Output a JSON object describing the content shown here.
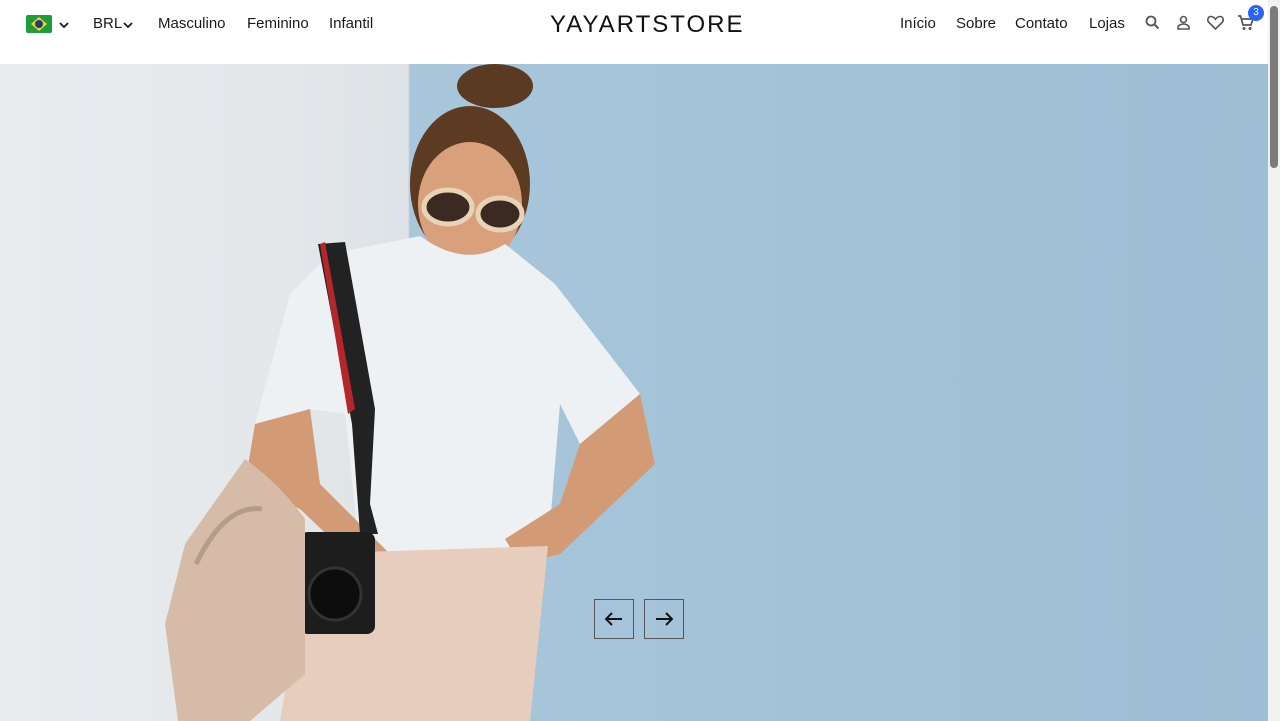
{
  "header": {
    "country": "Brasil",
    "currency": "BRL",
    "nav_left": [
      "Masculino",
      "Feminino",
      "Infantil"
    ],
    "logo": "YAYARTSTORE",
    "nav_right": [
      "Início",
      "Sobre",
      "Contato",
      "Lojas"
    ],
    "cart_count": "3",
    "icons": [
      "search-icon",
      "user-icon",
      "heart-icon",
      "cart-icon"
    ]
  },
  "hero": {
    "image": "woman-with-camera-photo"
  },
  "colors": {
    "badge": "#2962ff",
    "wall_white": "#e6e9ec",
    "wall_blue": "#a3c2d8"
  }
}
